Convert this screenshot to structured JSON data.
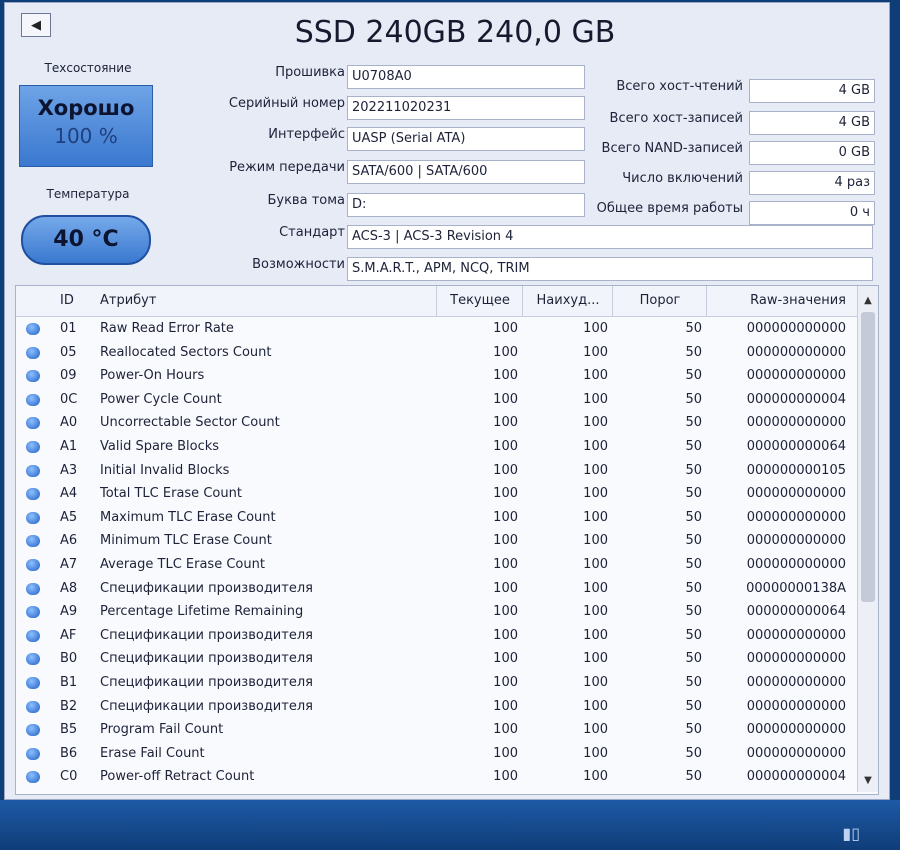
{
  "title": "SSD 240GB 240,0 GB",
  "health": {
    "label": "Техсостояние",
    "status": "Хорошо",
    "percent": "100 %"
  },
  "temperature": {
    "label": "Температура",
    "value": "40 °C"
  },
  "info": {
    "firmware": {
      "label": "Прошивка",
      "value": "U0708A0"
    },
    "serial": {
      "label": "Серийный номер",
      "value": "202211020231"
    },
    "interface": {
      "label": "Интерфейс",
      "value": "UASP (Serial ATA)"
    },
    "transfer_mode": {
      "label": "Режим передачи",
      "value": "SATA/600 | SATA/600"
    },
    "drive_letter": {
      "label": "Буква тома",
      "value": "D:"
    },
    "standard": {
      "label": "Стандарт",
      "value": "ACS-3 | ACS-3 Revision 4"
    },
    "features": {
      "label": "Возможности",
      "value": "S.M.A.R.T., APM, NCQ, TRIM"
    }
  },
  "stats": {
    "host_reads": {
      "label": "Всего хост-чтений",
      "value": "4 GB"
    },
    "host_writes": {
      "label": "Всего хост-записей",
      "value": "4 GB"
    },
    "nand_writes": {
      "label": "Всего NAND-записей",
      "value": "0 GB"
    },
    "power_on_count": {
      "label": "Число включений",
      "value": "4 раз"
    },
    "power_on_hours": {
      "label": "Общее время работы",
      "value": "0 ч"
    }
  },
  "table": {
    "headers": {
      "id": "ID",
      "attribute": "Атрибут",
      "current": "Текущее",
      "worst": "Наихуд...",
      "threshold": "Порог",
      "raw": "Raw-значения"
    },
    "rows": [
      {
        "id": "01",
        "name": "Raw Read Error Rate",
        "cur": "100",
        "worst": "100",
        "thr": "50",
        "raw": "000000000000"
      },
      {
        "id": "05",
        "name": "Reallocated Sectors Count",
        "cur": "100",
        "worst": "100",
        "thr": "50",
        "raw": "000000000000"
      },
      {
        "id": "09",
        "name": "Power-On Hours",
        "cur": "100",
        "worst": "100",
        "thr": "50",
        "raw": "000000000000"
      },
      {
        "id": "0C",
        "name": "Power Cycle Count",
        "cur": "100",
        "worst": "100",
        "thr": "50",
        "raw": "000000000004"
      },
      {
        "id": "A0",
        "name": "Uncorrectable Sector Count",
        "cur": "100",
        "worst": "100",
        "thr": "50",
        "raw": "000000000000"
      },
      {
        "id": "A1",
        "name": "Valid Spare Blocks",
        "cur": "100",
        "worst": "100",
        "thr": "50",
        "raw": "000000000064"
      },
      {
        "id": "A3",
        "name": "Initial Invalid Blocks",
        "cur": "100",
        "worst": "100",
        "thr": "50",
        "raw": "000000000105"
      },
      {
        "id": "A4",
        "name": "Total TLC Erase Count",
        "cur": "100",
        "worst": "100",
        "thr": "50",
        "raw": "000000000000"
      },
      {
        "id": "A5",
        "name": "Maximum TLC Erase Count",
        "cur": "100",
        "worst": "100",
        "thr": "50",
        "raw": "000000000000"
      },
      {
        "id": "A6",
        "name": "Minimum TLC Erase Count",
        "cur": "100",
        "worst": "100",
        "thr": "50",
        "raw": "000000000000"
      },
      {
        "id": "A7",
        "name": "Average TLC Erase Count",
        "cur": "100",
        "worst": "100",
        "thr": "50",
        "raw": "000000000000"
      },
      {
        "id": "A8",
        "name": "Спецификации производителя",
        "cur": "100",
        "worst": "100",
        "thr": "50",
        "raw": "00000000138A"
      },
      {
        "id": "A9",
        "name": "Percentage Lifetime Remaining",
        "cur": "100",
        "worst": "100",
        "thr": "50",
        "raw": "000000000064"
      },
      {
        "id": "AF",
        "name": "Спецификации производителя",
        "cur": "100",
        "worst": "100",
        "thr": "50",
        "raw": "000000000000"
      },
      {
        "id": "B0",
        "name": "Спецификации производителя",
        "cur": "100",
        "worst": "100",
        "thr": "50",
        "raw": "000000000000"
      },
      {
        "id": "B1",
        "name": "Спецификации производителя",
        "cur": "100",
        "worst": "100",
        "thr": "50",
        "raw": "000000000000"
      },
      {
        "id": "B2",
        "name": "Спецификации производителя",
        "cur": "100",
        "worst": "100",
        "thr": "50",
        "raw": "000000000000"
      },
      {
        "id": "B5",
        "name": "Program Fail Count",
        "cur": "100",
        "worst": "100",
        "thr": "50",
        "raw": "000000000000"
      },
      {
        "id": "B6",
        "name": "Erase Fail Count",
        "cur": "100",
        "worst": "100",
        "thr": "50",
        "raw": "000000000000"
      },
      {
        "id": "C0",
        "name": "Power-off Retract Count",
        "cur": "100",
        "worst": "100",
        "thr": "50",
        "raw": "000000000004"
      }
    ]
  }
}
